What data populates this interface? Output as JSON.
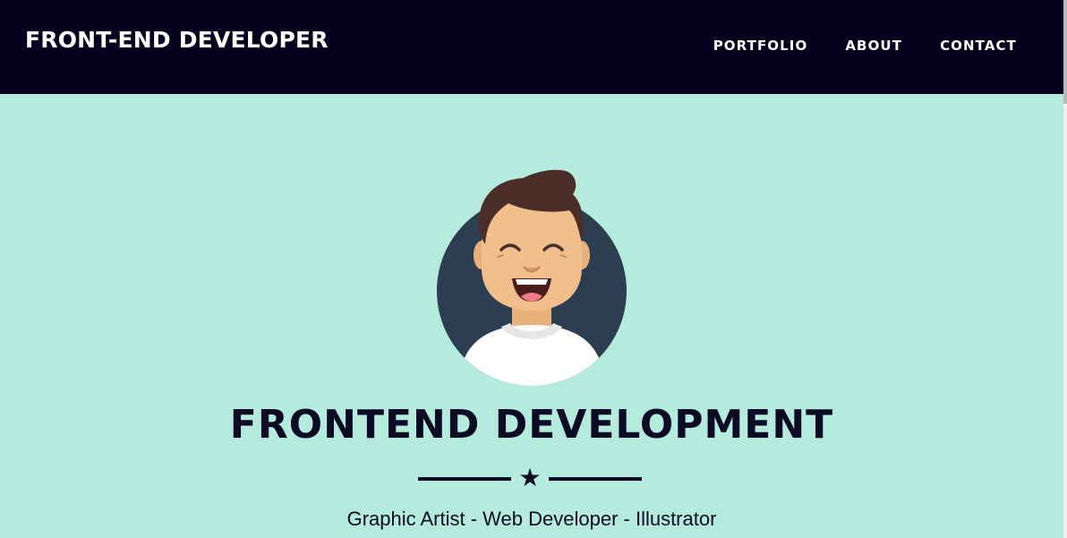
{
  "header": {
    "brand": "FRONT-END DEVELOPER",
    "nav": [
      {
        "label": "PORTFOLIO"
      },
      {
        "label": "ABOUT"
      },
      {
        "label": "CONTACT"
      }
    ]
  },
  "masthead": {
    "avatar_icon": "smiling-developer-avatar-icon",
    "title": "FRONTEND DEVELOPMENT",
    "divider_icon": "star-icon",
    "divider_glyph": "★",
    "subtitle": "Graphic Artist - Web Developer - Illustrator"
  },
  "colors": {
    "navbar_bg": "#02001c",
    "page_bg": "#b4ebdc",
    "text_dark": "#0c0b25",
    "avatar_circle": "#2c3e50",
    "skin": "#f0bf8b",
    "hair": "#4b2e2a",
    "shirt": "#ffffff"
  }
}
